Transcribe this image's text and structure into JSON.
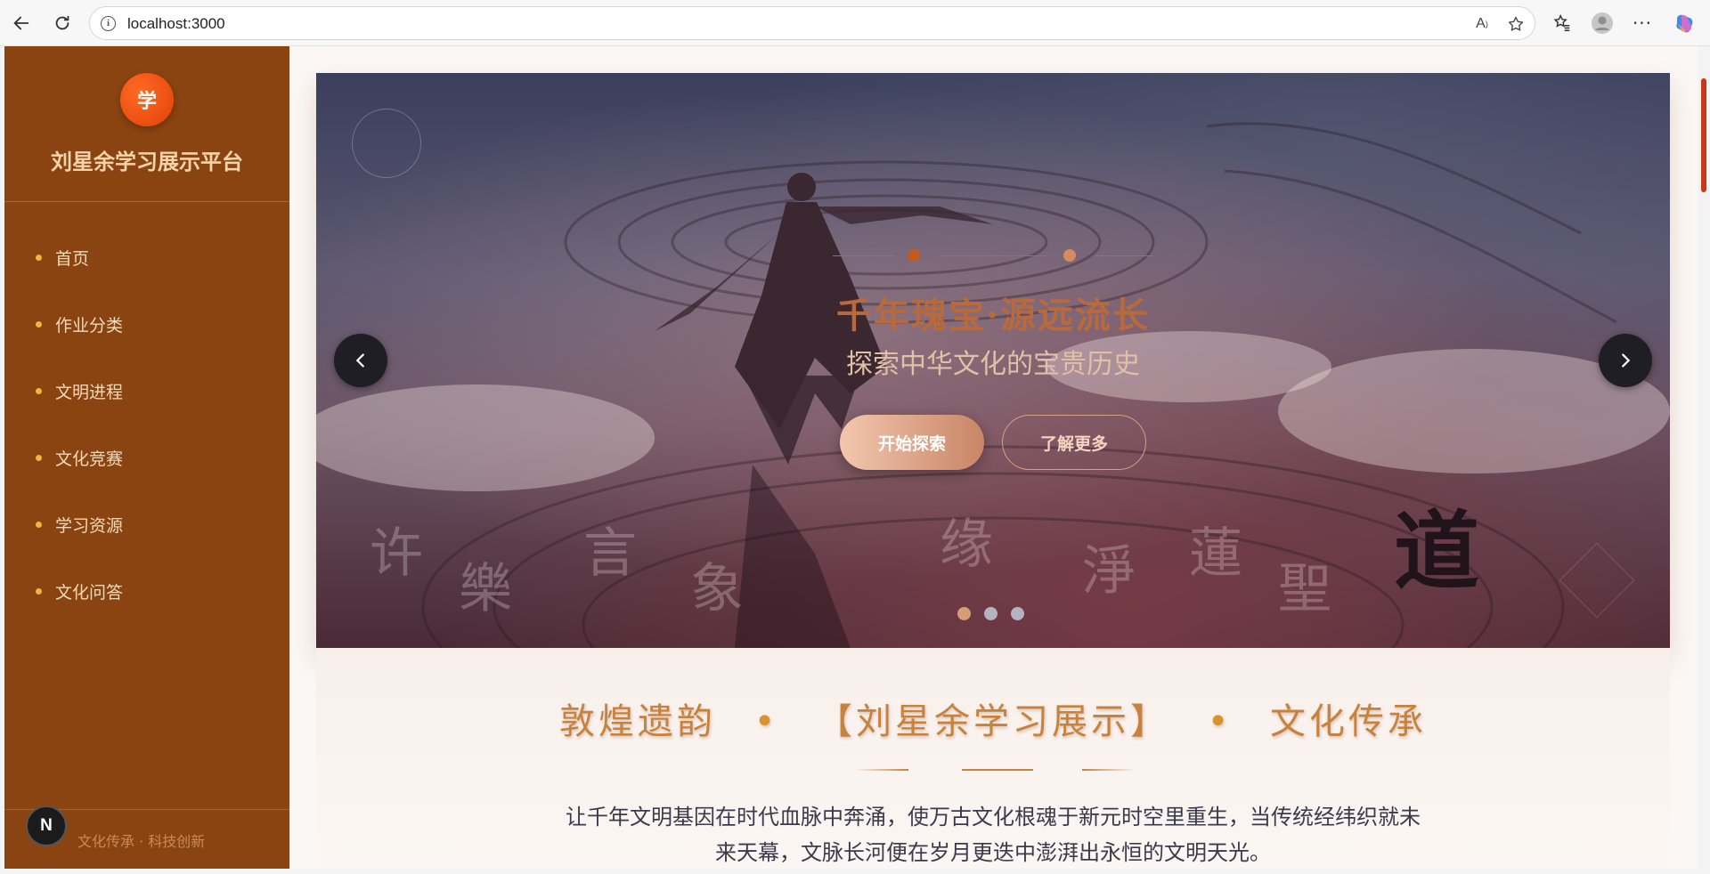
{
  "browser": {
    "url": "localhost:3000"
  },
  "sidebar": {
    "logo_char": "学",
    "site_title": "刘星余学习展示平台",
    "items": [
      {
        "label": "首页"
      },
      {
        "label": "作业分类"
      },
      {
        "label": "文明进程"
      },
      {
        "label": "文化竞赛"
      },
      {
        "label": "学习资源"
      },
      {
        "label": "文化问答"
      }
    ],
    "badge_letter": "N",
    "footer_text": "文化传承 · 科技创新"
  },
  "hero": {
    "title": "千年瑰宝·源远流长",
    "subtitle": "探索中华文化的宝贵历史",
    "primary_button": "开始探索",
    "secondary_button": "了解更多",
    "calligraphy_char": "道",
    "active_slide": 1,
    "slide_count": 3
  },
  "intro": {
    "title_part1": "敦煌遗韵",
    "title_separator": "•",
    "title_part2": "【刘星余学习展示】",
    "title_part3": "文化传承",
    "text": "让千年文明基因在时代血脉中奔涌，使万古文化根魂于新元时空里重生，当传统经纬织就未来天幕，文脉长河便在岁月更迭中澎湃出永恒的文明天光。"
  },
  "colors": {
    "sidebar_bg": "#8a4411",
    "accent_orange": "#e2400b",
    "menu_dot": "#f0b440",
    "hero_title": "#b96a3c",
    "intro_title": "#c7823d"
  }
}
